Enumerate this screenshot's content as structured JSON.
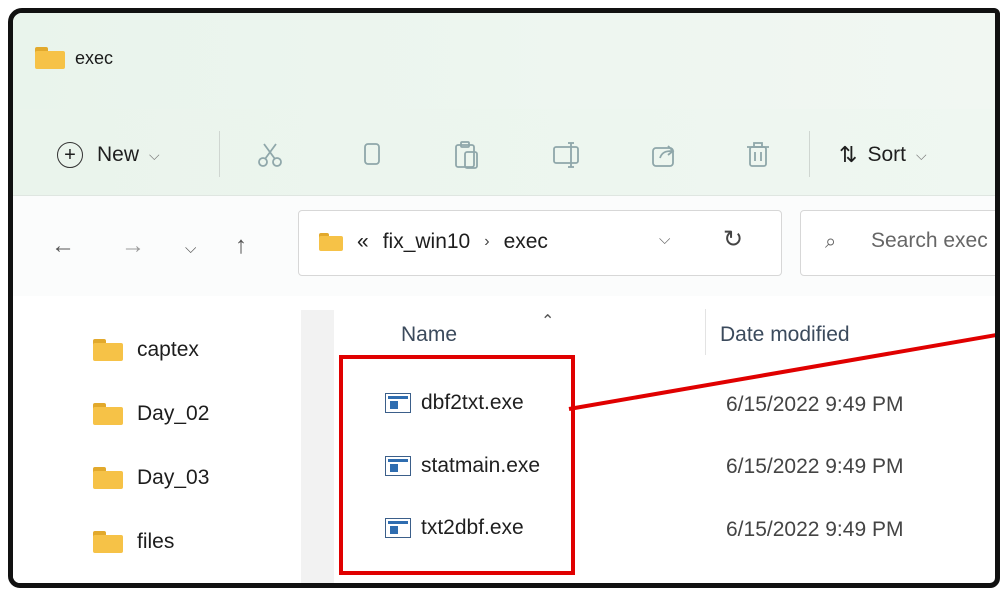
{
  "window": {
    "title": "exec"
  },
  "toolbar": {
    "new_label": "New",
    "sort_label": "Sort"
  },
  "address": {
    "overflow": "«",
    "crumbs": [
      "fix_win10",
      "exec"
    ]
  },
  "search": {
    "placeholder": "Search exec"
  },
  "sidebar": {
    "items": [
      {
        "label": "captex"
      },
      {
        "label": "Day_02"
      },
      {
        "label": "Day_03"
      },
      {
        "label": "files"
      }
    ]
  },
  "columns": {
    "name": "Name",
    "date_modified": "Date modified"
  },
  "files": [
    {
      "name": "dbf2txt.exe",
      "date": "6/15/2022 9:49 PM"
    },
    {
      "name": "statmain.exe",
      "date": "6/15/2022 9:49 PM"
    },
    {
      "name": "txt2dbf.exe",
      "date": "6/15/2022 9:49 PM"
    }
  ],
  "colors": {
    "annotation": "#e00000",
    "folder": "#f6c247",
    "accent": "#2f6db0"
  },
  "icons": [
    "folder-icon",
    "plus-circle-icon",
    "cut-icon",
    "copy-icon",
    "paste-icon",
    "rename-icon",
    "share-icon",
    "delete-icon",
    "sort-icon",
    "back-icon",
    "forward-icon",
    "recent-icon",
    "up-icon",
    "refresh-icon",
    "search-icon",
    "exe-icon"
  ]
}
